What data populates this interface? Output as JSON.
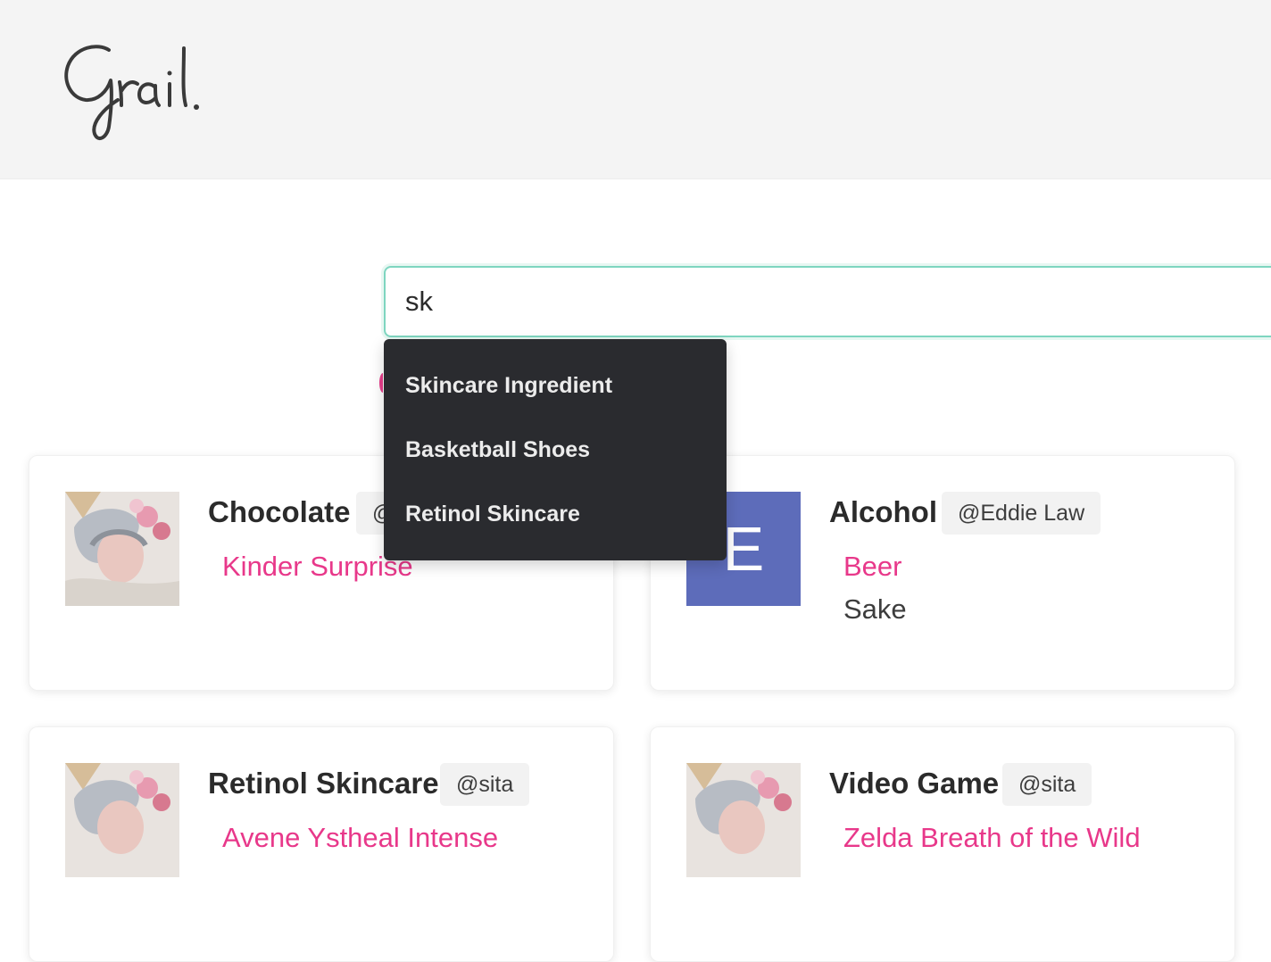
{
  "header": {
    "logo_text": "Grail."
  },
  "search": {
    "value": "sk",
    "suggestions": [
      "Skincare Ingredient",
      "Basketball Shoes",
      "Retinol Skincare"
    ]
  },
  "cards": [
    {
      "title": "Chocolate",
      "user": "@sita",
      "avatar": "illustration-avatar",
      "items": [
        {
          "label": "Kinder Surprise",
          "style": "pink"
        }
      ]
    },
    {
      "title": "Alcohol",
      "user": "@Eddie Law",
      "avatar": "letter-avatar",
      "avatar_letter": "E",
      "avatar_color": "#5d6cba",
      "items": [
        {
          "label": "Beer",
          "style": "pink"
        },
        {
          "label": "Sake",
          "style": "grey"
        }
      ]
    },
    {
      "title": "Retinol Skincare",
      "user": "@sita",
      "avatar": "illustration-avatar",
      "items": [
        {
          "label": "Avene Ystheal Intense",
          "style": "pink"
        }
      ]
    },
    {
      "title": "Video Game",
      "user": "@sita",
      "avatar": "illustration-avatar",
      "items": [
        {
          "label": "Zelda Breath of the Wild",
          "style": "pink"
        }
      ]
    }
  ],
  "colors": {
    "accent_pink": "#e8388a",
    "search_border": "#7ed6c0",
    "dropdown_bg": "#2a2b2f",
    "header_bg": "#f4f4f4"
  }
}
